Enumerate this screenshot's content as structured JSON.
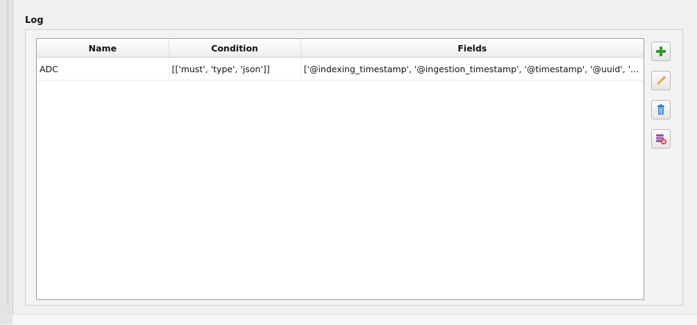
{
  "group": {
    "title": "Log"
  },
  "table": {
    "columns": [
      "Name",
      "Condition",
      "Fields"
    ],
    "rows": [
      {
        "name": "ADC",
        "condition": "[['must', 'type', 'json']]",
        "fields": "['@indexing_timestamp', '@ingestion_timestamp', '@timestamp', '@uuid', '..."
      }
    ]
  },
  "toolbar": {
    "buttons": [
      {
        "icon": "plus-icon",
        "color": "#2f9a2f"
      },
      {
        "icon": "pencil-icon",
        "color": "#e07a1f"
      },
      {
        "icon": "trash-icon",
        "color": "#1e73c9"
      },
      {
        "icon": "clear-all-icon",
        "color": "#8a4aa0"
      }
    ]
  }
}
